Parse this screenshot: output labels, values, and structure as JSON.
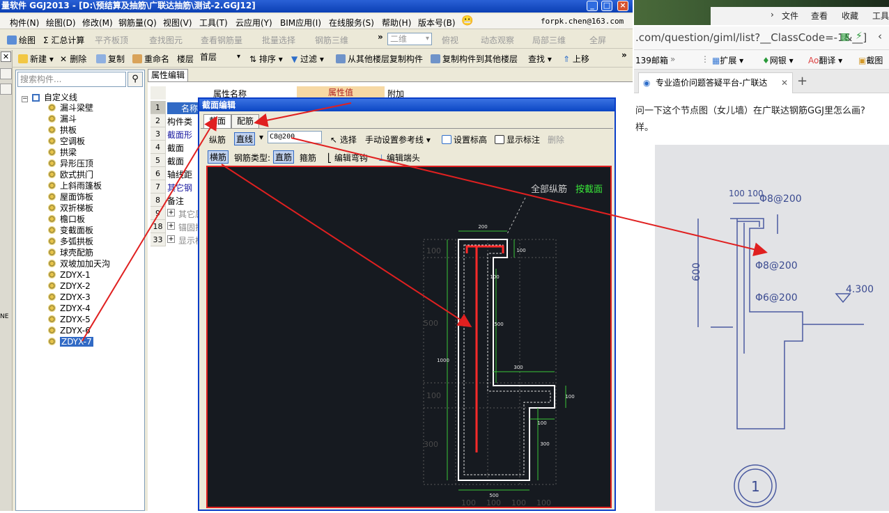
{
  "app": {
    "title": "量软件 GGJ2013 - [D:\\预结算及抽筋\\广联达抽筋\\测试-2.GGJ12]",
    "menu": [
      "构件(N)",
      "绘图(D)",
      "修改(M)",
      "钢筋量(Q)",
      "视图(V)",
      "工具(T)",
      "云应用(Y)",
      "BIM应用(I)",
      "在线服务(S)",
      "帮助(H)",
      "版本号(B)"
    ],
    "account": "forpk.chen@163.com",
    "toolbar1": {
      "draw": "绘图",
      "summary": "Σ 汇总计算",
      "flat": "平齐板顶",
      "find": "查找图元",
      "view_rebar": "查看钢筋量",
      "batch": "批量选择",
      "rebar3d": "钢筋三维",
      "mode": "二维",
      "view": "俯视",
      "dynamic": "动态观察",
      "local3d": "局部三维",
      "fullscreen": "全屏"
    },
    "toolbar2": {
      "new": "新建",
      "delete": "删除",
      "copy": "复制",
      "rename": "重命名",
      "floor_label": "楼层",
      "floor_value": "首层",
      "sort": "排序",
      "filter": "过滤",
      "copy_from": "从其他楼层复制构件",
      "copy_to": "复制构件到其他楼层",
      "find": "查找",
      "move_up": "上移"
    },
    "left_tab_text": "NE"
  },
  "tree": {
    "search_placeholder": "搜索构件...",
    "root": "自定义线",
    "items": [
      "漏斗梁壁",
      "漏斗",
      "拱板",
      "空调板",
      "拱梁",
      "异形压顶",
      "欧式拱门",
      "上斜雨篷板",
      "屋面饰板",
      "双折梯板",
      "檐口板",
      "变截面板",
      "多弧拱板",
      "球壳配筋",
      "双坡加加天沟",
      "ZDYX-1",
      "ZDYX-2",
      "ZDYX-3",
      "ZDYX-4",
      "ZDYX-5",
      "ZDYX-6",
      "ZDYX-7"
    ],
    "selected": "ZDYX-7"
  },
  "props": {
    "tab": "属性编辑",
    "headers": [
      "属性名称",
      "属性值",
      "附加"
    ],
    "rows": [
      {
        "num": "1",
        "name": "名称"
      },
      {
        "num": "2",
        "name": "构件类"
      },
      {
        "num": "3",
        "name": "截面形"
      },
      {
        "num": "4",
        "name": "截面"
      },
      {
        "num": "5",
        "name": "截面"
      },
      {
        "num": "6",
        "name": "轴线距"
      },
      {
        "num": "7",
        "name": "其它钢"
      },
      {
        "num": "8",
        "name": "备注"
      },
      {
        "num": "9",
        "name": "其它属"
      },
      {
        "num": "18",
        "name": "锚固搭"
      },
      {
        "num": "33",
        "name": "显示样"
      }
    ]
  },
  "dialog": {
    "title": "截面编辑",
    "tabs": [
      "截面",
      "配筋"
    ],
    "row1": {
      "longit": "纵筋",
      "line": "直线",
      "spec": "C8@200",
      "select": "选择",
      "manual": "手动设置参考线",
      "elev": "设置标高",
      "show_mark": "显示标注",
      "delete": "删除"
    },
    "row2": {
      "transverse": "横筋",
      "type_label": "钢筋类型:",
      "straight": "直筋",
      "stirrup": "箍筋",
      "edit_hook": "编辑弯钩",
      "edit_end": "编辑端头"
    },
    "canvas": {
      "label_all": "全部纵筋",
      "label_section": "按截面",
      "dims": {
        "top_width": "200",
        "top_right": "100",
        "inner_top": "100",
        "upper_h": "500",
        "left_total": "1000",
        "mid_right": "300",
        "right_h": "100",
        "step_w": "100",
        "lower_h": "300",
        "bottom_w": "500"
      },
      "left_scale": [
        "100",
        "500",
        "100",
        "300"
      ],
      "bottom_scale": [
        "100",
        "100",
        "100",
        "100"
      ]
    }
  },
  "browser": {
    "menu": [
      "文件",
      "查看",
      "收藏",
      "工具"
    ],
    "url": ".com/question/giml/list?__ClassCode=-1&__]",
    "fav": [
      "139邮箱",
      "扩展",
      "网银",
      "翻译",
      "截图"
    ],
    "tab_title": "专业造价问题答疑平台-广联达",
    "question": [
      "问一下这个节点图（女儿墙）在广联达钢筋GGJ里怎么画?",
      "样。"
    ],
    "sketch": {
      "top_dim": "100 100",
      "top_bar": "Φ8@200",
      "side_h": "600",
      "mid_bar": "Φ8@200",
      "low_bar": "Φ6@200",
      "elev": "4.300",
      "circle": "1"
    }
  },
  "colors": {
    "accent_red": "#e02020",
    "canvas_bg": "#161a20",
    "title_blue": "#0b46c4",
    "selection": "#316ac5"
  }
}
